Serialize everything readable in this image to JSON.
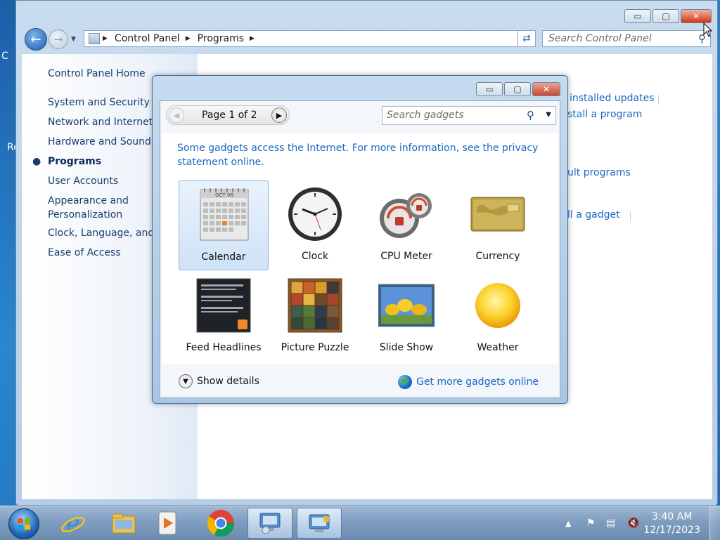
{
  "desktop": {
    "letters": [
      "C",
      "Re"
    ]
  },
  "control_panel": {
    "caption_buttons": {
      "minimize": "▭",
      "maximize": "▢",
      "close": "✕"
    },
    "breadcrumbs": [
      "Control Panel",
      "Programs"
    ],
    "search_placeholder": "Search Control Panel",
    "left_nav": {
      "home": "Control Panel Home",
      "items": [
        "System and Security",
        "Network and Internet",
        "Hardware and Sound",
        "Programs",
        "User Accounts",
        "Appearance and",
        "Personalization",
        "Clock, Language, and Re",
        "Ease of Access"
      ],
      "current": "Programs"
    },
    "right_links": [
      "installed updates",
      "stall a program",
      "ult programs",
      "ll a gadget"
    ]
  },
  "gadgets_dialog": {
    "caption_buttons": {
      "minimize": "▭",
      "maximize": "▢",
      "close": "✕"
    },
    "pager_label": "Page 1 of 2",
    "search_placeholder": "Search gadgets",
    "notice": "Some gadgets access the Internet.  For more information, see the privacy statement online.",
    "gadgets": [
      {
        "name": "Calendar",
        "icon": "calendar-icon",
        "selected": true
      },
      {
        "name": "Clock",
        "icon": "clock-icon"
      },
      {
        "name": "CPU Meter",
        "icon": "cpu-meter-icon"
      },
      {
        "name": "Currency",
        "icon": "currency-icon"
      },
      {
        "name": "Feed Headlines",
        "icon": "feed-headlines-icon"
      },
      {
        "name": "Picture Puzzle",
        "icon": "picture-puzzle-icon"
      },
      {
        "name": "Slide Show",
        "icon": "slide-show-icon"
      },
      {
        "name": "Weather",
        "icon": "weather-icon"
      }
    ],
    "calendar_month": "OCT 06",
    "show_details": "Show details",
    "get_more": "Get more gadgets online"
  },
  "taskbar": {
    "apps": [
      "internet-explorer-icon",
      "file-explorer-icon",
      "media-player-icon",
      "chrome-icon",
      "control-panel-icon",
      "gadgets-icon"
    ],
    "time": "3:40 AM",
    "date": "12/17/2023"
  },
  "colors": {
    "link": "#1769c2",
    "nav_text": "#1a3c6e",
    "close_red": "#c74a30"
  }
}
